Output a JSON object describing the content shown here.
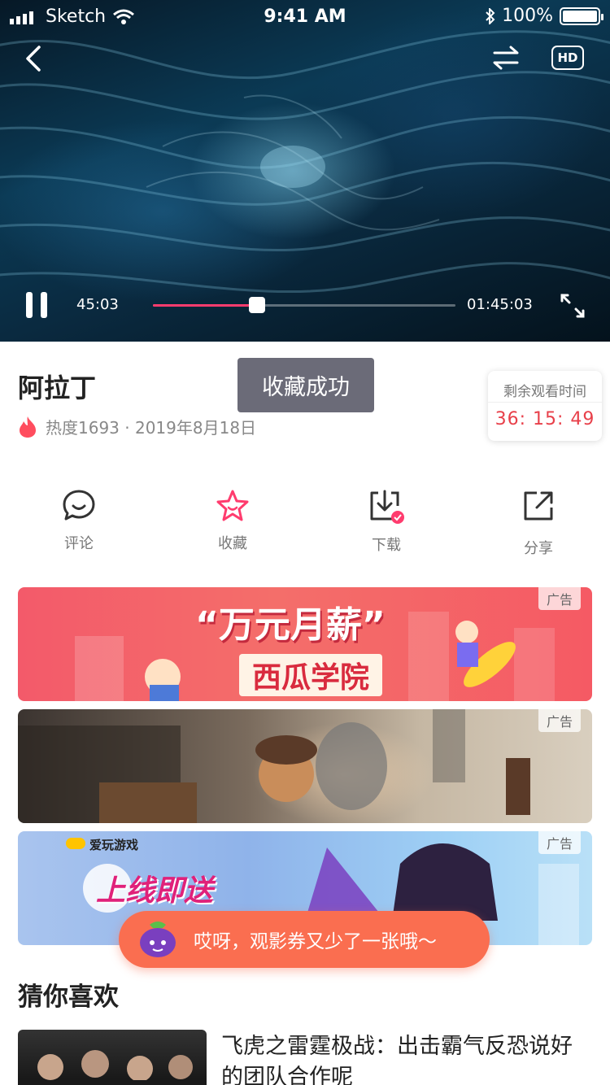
{
  "status_bar": {
    "carrier": "Sketch",
    "time": "9:41 AM",
    "battery": "100%"
  },
  "player": {
    "current_time": "45:03",
    "total_time": "01:45:03",
    "progress": 0.345,
    "hd_label": "HD"
  },
  "video_info": {
    "title": "阿拉丁",
    "meta": "热度1693 · 2019年8月18日"
  },
  "toast": "收藏成功",
  "remaining": {
    "label": "剩余观看时间",
    "value": "36: 15: 49"
  },
  "actions": [
    {
      "label": "评论",
      "icon": "comment-icon"
    },
    {
      "label": "收藏",
      "icon": "star-icon",
      "color": "#ff3c6e"
    },
    {
      "label": "下载",
      "icon": "download-icon"
    },
    {
      "label": "分享",
      "icon": "share-icon"
    }
  ],
  "ads": [
    {
      "tag": "广告",
      "headline": "“万元月薪”",
      "sub": "西瓜学院"
    },
    {
      "tag": "广告"
    },
    {
      "tag": "广告",
      "brand": "爱玩游戏",
      "headline": "上线即送"
    }
  ],
  "bubble": {
    "text": "哎呀，观影券又少了一张哦～"
  },
  "recommend": {
    "section_title": "猜你喜欢",
    "items": [
      {
        "title": "飞虎之雷霆极战：出击霸气反恐说好的团队合作呢"
      }
    ]
  },
  "colors": {
    "accent": "#ff3c6e",
    "bubble": "#fa6e50",
    "countdown": "#e8404a"
  }
}
